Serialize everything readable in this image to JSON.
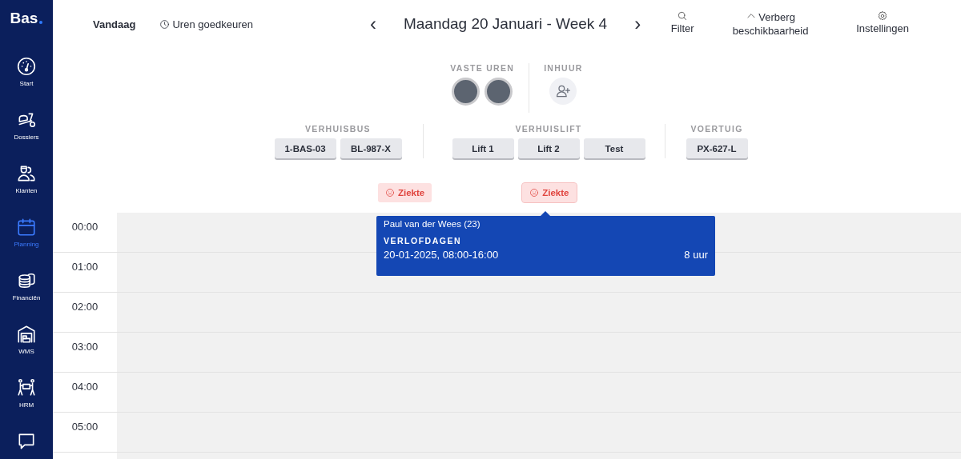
{
  "sidebar": {
    "logo": "Bas",
    "items": [
      {
        "label": "Start",
        "selected": false
      },
      {
        "label": "Dossiers",
        "selected": false
      },
      {
        "label": "Klanten",
        "selected": false
      },
      {
        "label": "Planning",
        "selected": true
      },
      {
        "label": "Financiën",
        "selected": false
      },
      {
        "label": "WMS",
        "selected": false
      },
      {
        "label": "HRM",
        "selected": false
      },
      {
        "selected": false
      }
    ]
  },
  "toolbar": {
    "today": "Vandaag",
    "approve_hours": "Uren goedkeuren",
    "prev": "‹",
    "title": "Maandag 20 Januari - Week 4",
    "next": "›",
    "actions": [
      {
        "label": "Filter"
      },
      {
        "label": "Verberg beschikbaarheid"
      },
      {
        "label": "Instellingen"
      }
    ]
  },
  "staff": [
    {
      "heading": "VASTE UREN",
      "kind": "avatars",
      "avatars": [
        {
          "kind": "photo"
        },
        {
          "kind": "photo"
        }
      ]
    },
    {
      "heading": "INHUUR",
      "kind": "add"
    }
  ],
  "resources": [
    {
      "heading": "VERHUISBUS",
      "items": [
        "1-BAS-03",
        "BL-987-X"
      ]
    },
    {
      "heading": "VERHUISLIFT",
      "items": [
        "Lift 1",
        "Lift 2",
        "Test"
      ]
    },
    {
      "heading": "VOERTUIG",
      "items": [
        "PX-627-L"
      ]
    }
  ],
  "absences": [
    {
      "label": "Ziekte",
      "selected": false
    },
    {
      "label": "Ziekte",
      "selected": true
    }
  ],
  "hours": [
    "00:00",
    "01:00",
    "02:00",
    "03:00",
    "04:00",
    "05:00"
  ],
  "popover": {
    "name": "Paul van der Wees (23)",
    "category": "VERLOFDAGEN",
    "period": "20-01-2025, 08:00-16:00",
    "duration": "8 uur"
  }
}
